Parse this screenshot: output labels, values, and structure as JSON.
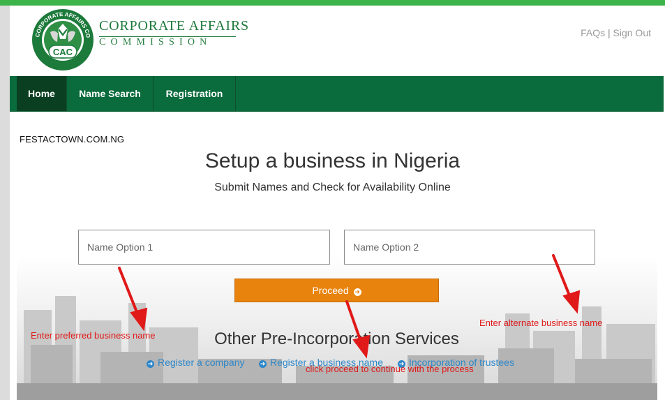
{
  "brand": {
    "name_line1": "CORPORATE AFFAIRS",
    "name_line2": "COMMISSION",
    "logo_text": "CAC",
    "logo_ring_text": "CORPORATE AFFAIRS COMMISSION"
  },
  "header": {
    "faqs_label": "FAQs",
    "separator": "|",
    "signout_label": "Sign Out"
  },
  "nav": {
    "items": [
      {
        "label": "Home",
        "active": true
      },
      {
        "label": "Name Search",
        "active": false
      },
      {
        "label": "Registration",
        "active": false
      }
    ]
  },
  "watermark": "FESTACTOWN.COM.NG",
  "main": {
    "title": "Setup a business in Nigeria",
    "subtitle": "Submit Names and Check for Availability Online",
    "name_option_1": {
      "placeholder": "Name Option 1",
      "value": ""
    },
    "name_option_2": {
      "placeholder": "Name Option 2",
      "value": ""
    },
    "proceed_label": "Proceed",
    "other_title": "Other Pre-Incorporation Services",
    "services": [
      {
        "label": "Register a company"
      },
      {
        "label": "Register a business name"
      },
      {
        "label": "Incorporation of trustees"
      }
    ]
  },
  "annotations": {
    "preferred": "Enter preferred business name",
    "alternate": "Enter alternate business name",
    "proceed": "click proceed to continue with the process"
  },
  "colors": {
    "top_strip": "#3cb44a",
    "nav_bg": "#0a6b3c",
    "nav_active": "#0b3f22",
    "proceed_button": "#e8830d",
    "link": "#2e87c8",
    "annotation": "#e01919",
    "brand_green": "#1f7a3c"
  },
  "icons": {
    "proceed": "circle-arrow-right-icon",
    "service_link": "circle-arrow-right-icon",
    "annotation_arrow": "red-arrow-icon"
  }
}
